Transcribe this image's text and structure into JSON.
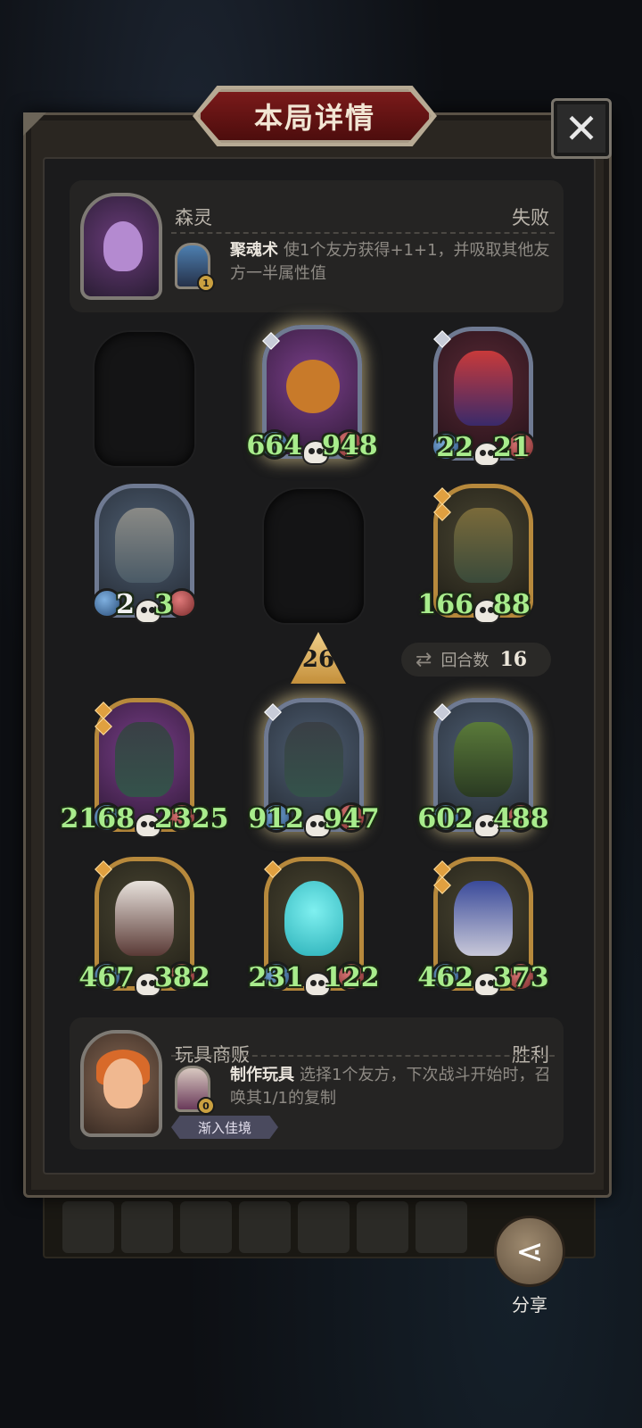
{
  "title": "本局详情",
  "close_label": "✕",
  "opponent": {
    "name": "森灵",
    "result": "失败",
    "skill_name": "聚魂术",
    "skill_desc": "使1个友方获得+1+1，并吸取其他友方一半属性值",
    "skill_badge": "1"
  },
  "opponent_board": [
    {
      "atk": null,
      "hp": null,
      "empty": true
    },
    {
      "atk": "664",
      "hp": "948",
      "art": "pumpkin"
    },
    {
      "atk": "22",
      "hp": "21",
      "art": "clown"
    },
    {
      "atk": "2",
      "hp": "3",
      "art": "robot"
    },
    {
      "atk": null,
      "hp": null,
      "empty": true
    },
    {
      "atk": "166",
      "hp": "88",
      "art": "witch-hat"
    }
  ],
  "level": "26",
  "rounds": {
    "label": "回合数",
    "value": "16"
  },
  "player_board": [
    {
      "atk": "2168",
      "hp": "2325",
      "art": "knight"
    },
    {
      "atk": "912",
      "hp": "947",
      "art": "knight"
    },
    {
      "atk": "602",
      "hp": "488",
      "art": "grinning-monster"
    },
    {
      "atk": "467",
      "hp": "382",
      "art": "rabbit-mask"
    },
    {
      "atk": "231",
      "hp": "122",
      "art": "ghost"
    },
    {
      "atk": "462",
      "hp": "373",
      "art": "wizard"
    }
  ],
  "player": {
    "name": "玩具商贩",
    "result": "胜利",
    "skill_name": "制作玩具",
    "skill_desc": "选择1个友方，下次战斗开始时，召唤其1/1的复制",
    "skill_badge": "0",
    "status_tag": "渐入佳境"
  },
  "share": {
    "label": "分享"
  },
  "colors": {
    "stat_green": "#a8ec8c",
    "panel_bg": "#252423",
    "title_red": "#7a1a1a"
  }
}
